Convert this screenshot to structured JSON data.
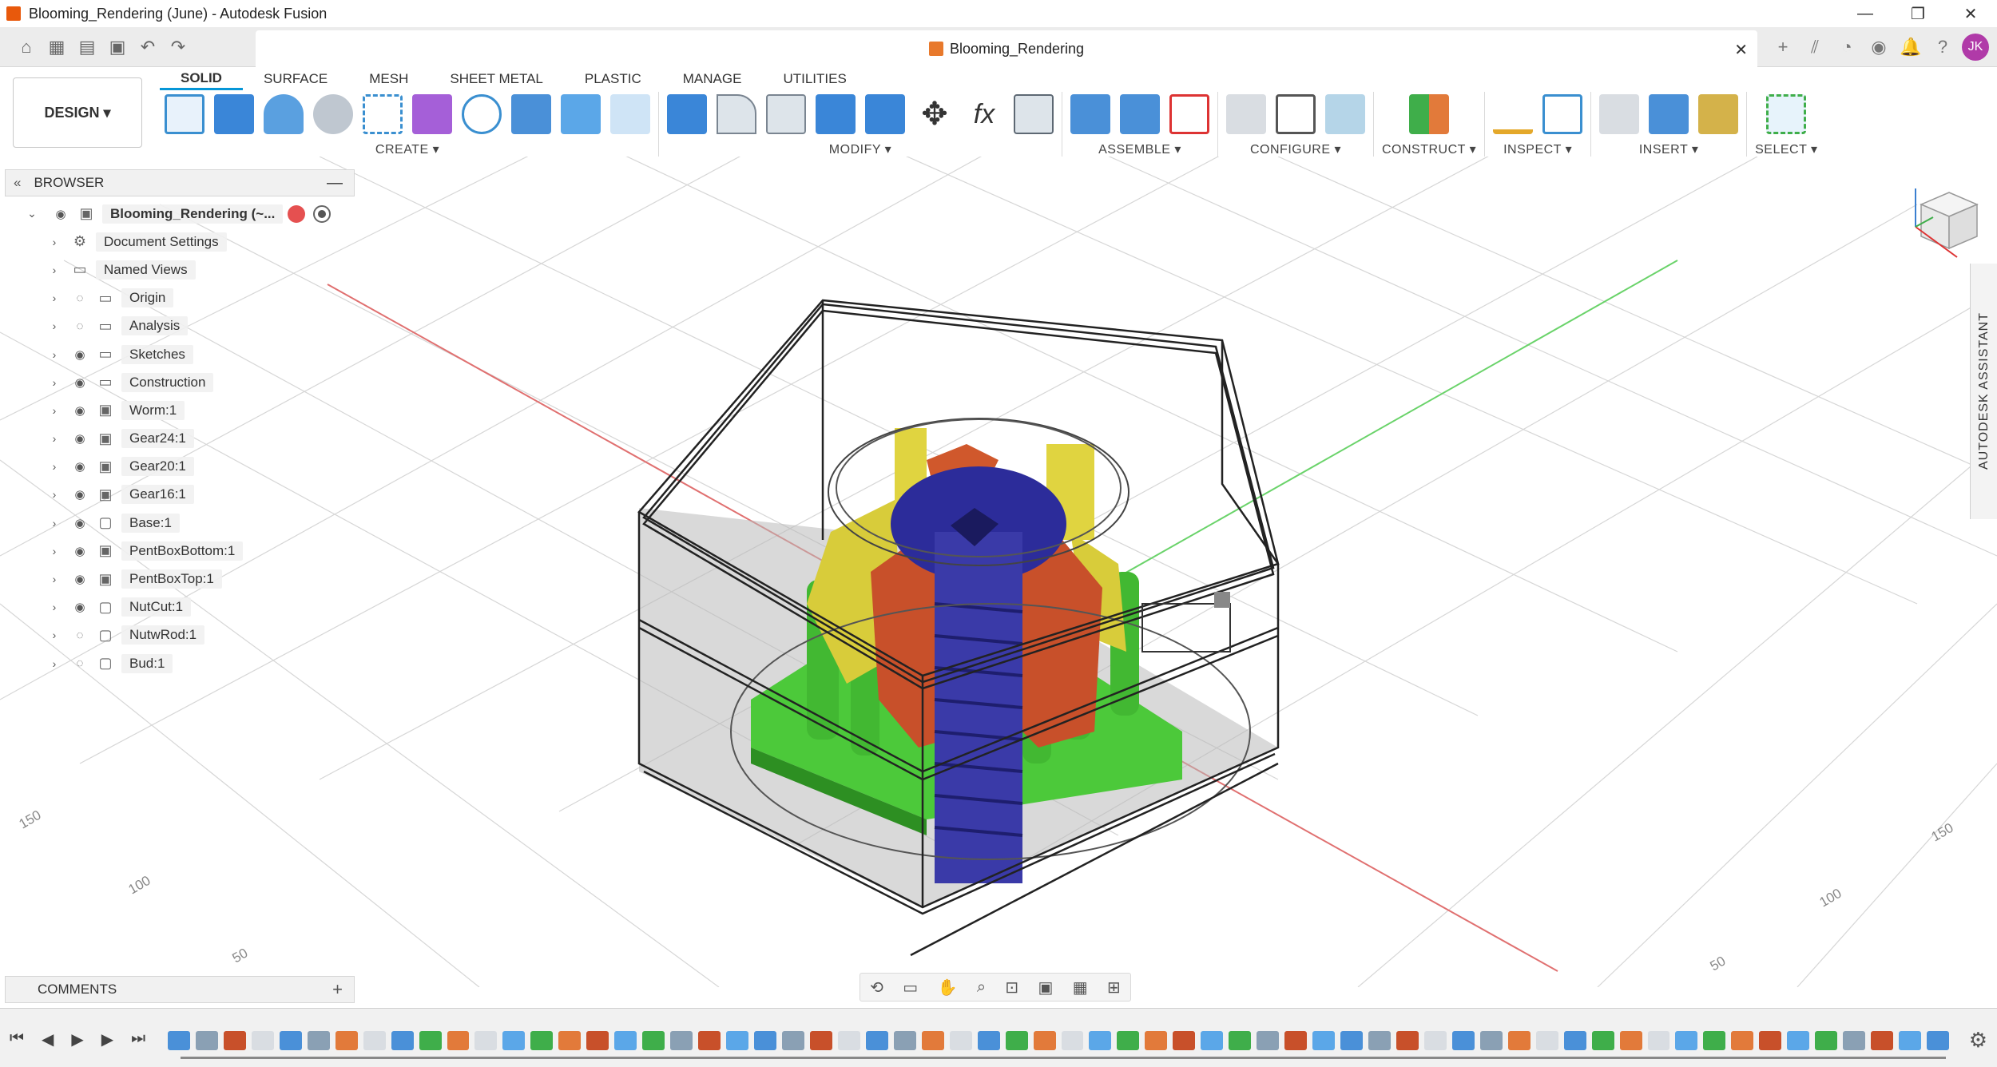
{
  "window": {
    "title": "Blooming_Rendering (June) - Autodesk Fusion",
    "controls": [
      "—",
      "❐",
      "✕"
    ]
  },
  "doc_tab": {
    "title": "Blooming_Rendering"
  },
  "user": {
    "initials": "JK"
  },
  "toolbar": {
    "design_label": "DESIGN ▾",
    "workspace_tabs": [
      "SOLID",
      "SURFACE",
      "MESH",
      "SHEET METAL",
      "PLASTIC",
      "MANAGE",
      "UTILITIES"
    ],
    "groups": [
      {
        "label": "CREATE ▾"
      },
      {
        "label": "MODIFY ▾"
      },
      {
        "label": "ASSEMBLE ▾"
      },
      {
        "label": "CONFIGURE ▾"
      },
      {
        "label": "CONSTRUCT ▾"
      },
      {
        "label": "INSPECT ▾"
      },
      {
        "label": "INSERT ▾"
      },
      {
        "label": "SELECT ▾"
      }
    ]
  },
  "browser": {
    "title": "BROWSER",
    "root": "Blooming_Rendering (~...",
    "items": [
      {
        "label": "Document Settings",
        "icon": "gear-icon",
        "visible": null
      },
      {
        "label": "Named Views",
        "icon": "folder-icon",
        "visible": null
      },
      {
        "label": "Origin",
        "icon": "folder-icon",
        "visible": false
      },
      {
        "label": "Analysis",
        "icon": "folder-icon",
        "visible": false
      },
      {
        "label": "Sketches",
        "icon": "folder-icon",
        "visible": true
      },
      {
        "label": "Construction",
        "icon": "folder-icon",
        "visible": true
      },
      {
        "label": "Worm:1",
        "icon": "component-icon",
        "visible": true
      },
      {
        "label": "Gear24:1",
        "icon": "component-icon",
        "visible": true
      },
      {
        "label": "Gear20:1",
        "icon": "component-icon",
        "visible": true
      },
      {
        "label": "Gear16:1",
        "icon": "component-icon",
        "visible": true
      },
      {
        "label": "Base:1",
        "icon": "body-icon",
        "visible": true
      },
      {
        "label": "PentBoxBottom:1",
        "icon": "component-icon",
        "visible": true
      },
      {
        "label": "PentBoxTop:1",
        "icon": "component-icon",
        "visible": true
      },
      {
        "label": "NutCut:1",
        "icon": "body-icon",
        "visible": true
      },
      {
        "label": "NutwRod:1",
        "icon": "body-icon",
        "visible": false
      },
      {
        "label": "Bud:1",
        "icon": "body-icon",
        "visible": false
      }
    ]
  },
  "comments": {
    "title": "COMMENTS"
  },
  "assistant": {
    "label": "AUTODESK ASSISTANT"
  },
  "grid_labels": {
    "left": [
      "150",
      "100",
      "50"
    ],
    "right": [
      "150",
      "100",
      "50"
    ]
  },
  "colors": {
    "accent": "#0696d7",
    "model_green": "#4cc93a",
    "model_yellow": "#d8cc3a",
    "model_red": "#c8502a",
    "model_blue": "#2c2c9a",
    "avatar": "#b03aa8"
  }
}
